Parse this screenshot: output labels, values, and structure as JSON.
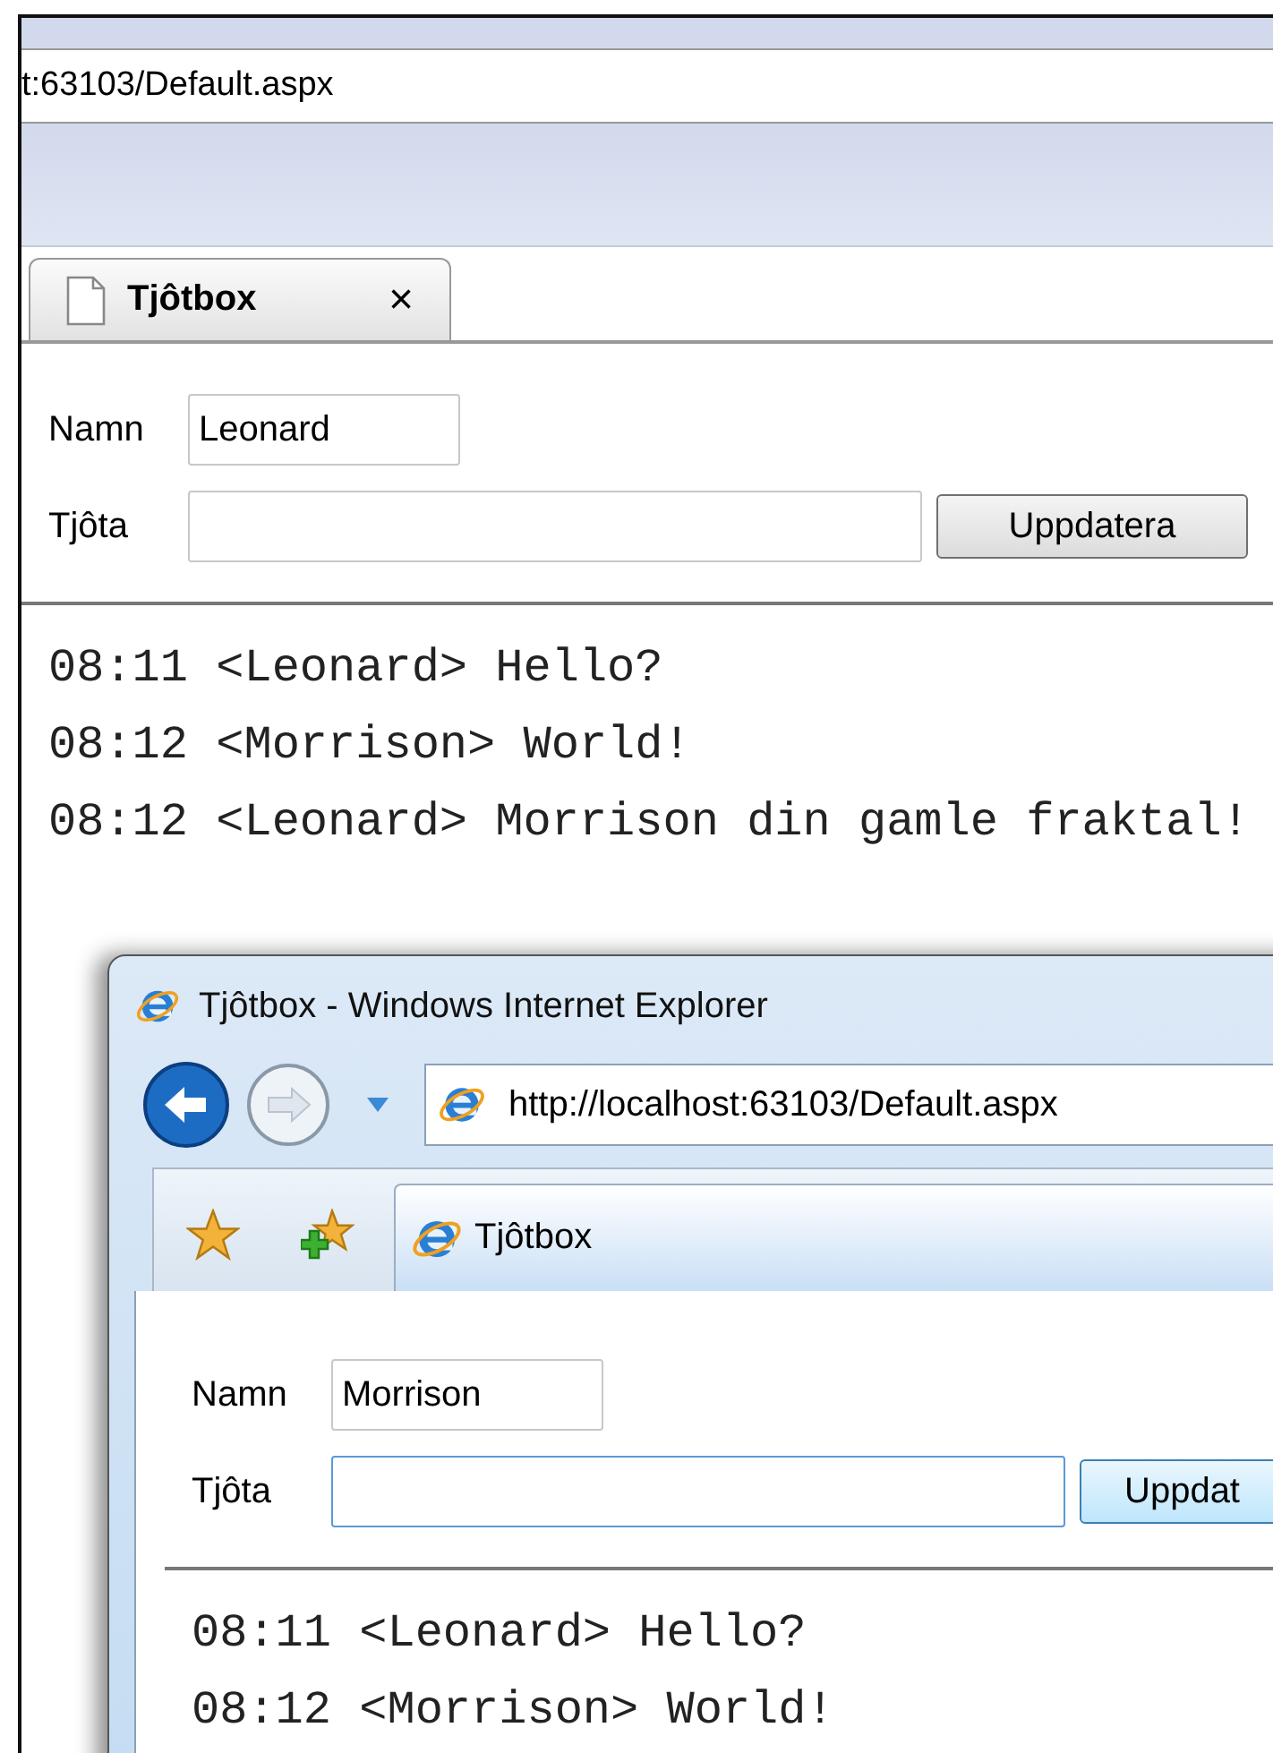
{
  "back_window": {
    "address": "t:63103/Default.aspx",
    "tab": {
      "label": "Tjôtbox",
      "close": "×"
    },
    "form": {
      "name_label": "Namn",
      "name_value": "Leonard",
      "message_label": "Tjôta",
      "message_focused": false,
      "button": "Uppdatera"
    },
    "messages": [
      "08:11 <Leonard> Hello?",
      "08:12 <Morrison> World!",
      "08:12 <Leonard> Morrison din gamle fraktal!"
    ]
  },
  "front_window": {
    "title": "Tjôtbox - Windows Internet Explorer",
    "address": "http://localhost:63103/Default.aspx",
    "tab": {
      "label": "Tjôtbox"
    },
    "form": {
      "name_label": "Namn",
      "name_value": "Morrison",
      "message_label": "Tjôta",
      "message_focused": true,
      "button": "Uppdat"
    },
    "messages": [
      "08:11 <Leonard> Hello?",
      "08:12 <Morrison> World!"
    ]
  }
}
